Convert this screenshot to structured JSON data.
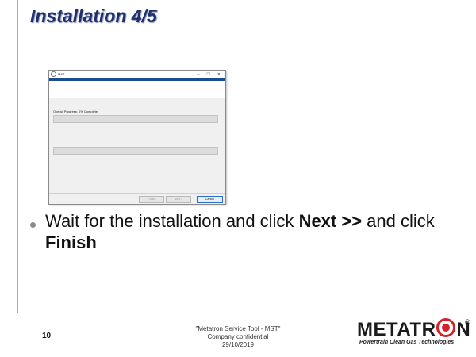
{
  "slide": {
    "title": "Installation 4/5",
    "bullet_parts": [
      "Wait for the installation and click ",
      "Next >>",
      " and click ",
      "Finish"
    ],
    "page_number": "10",
    "footer_lines": [
      "\"Metatron Service Tool - MST\"",
      "Company confidential",
      "29/10/2019"
    ]
  },
  "logo": {
    "brand_prefix": "METATR",
    "brand_suffix": "N",
    "registered": "®",
    "tagline": "Powertrain Clean Gas Technologies"
  },
  "installer": {
    "window_title": "MST",
    "controls": {
      "minimize": "–",
      "maximize": "☐",
      "close": "✕"
    },
    "progress_label": "Overall Progress: 0% Complete",
    "overall_progress": 0,
    "step_progress": 0,
    "buttons": {
      "back": "< Back",
      "next": "Next >",
      "cancel": "Cancel"
    },
    "colors": {
      "accent_band": "#1a4d8c",
      "default_button_border": "#2a6ec9"
    }
  },
  "colors": {
    "title": "#1f2f6e",
    "logo_o": "#d3222a"
  }
}
